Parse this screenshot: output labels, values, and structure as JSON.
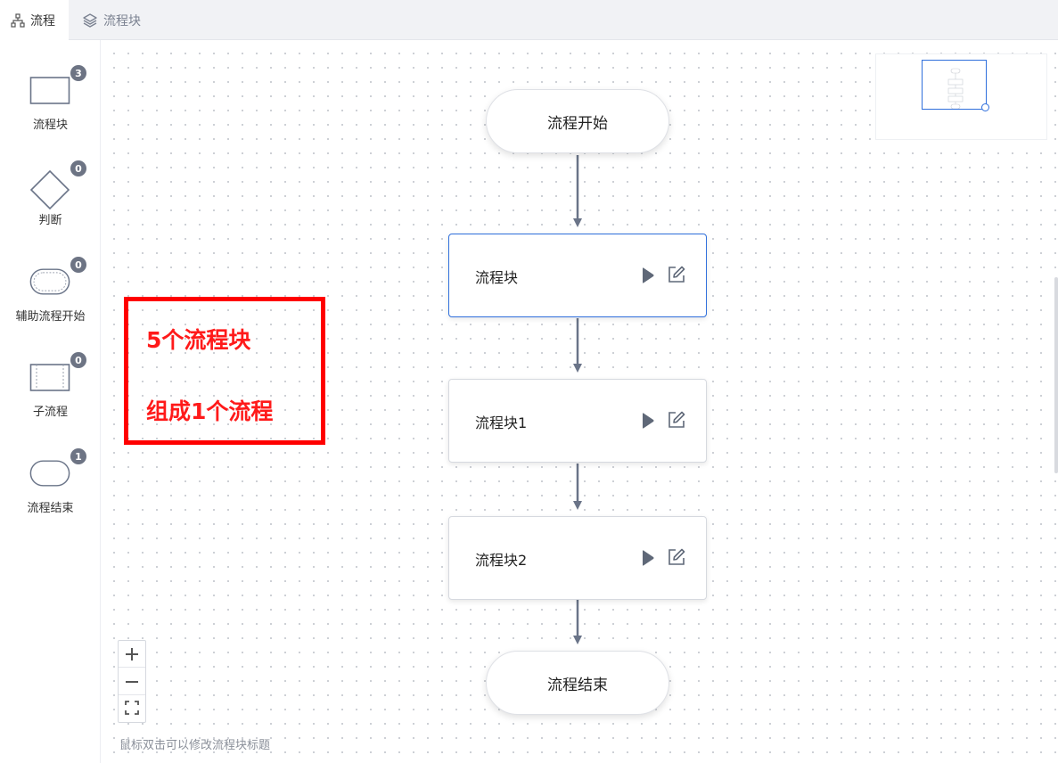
{
  "tabs": [
    {
      "label": "流程",
      "icon": "sitemap-icon",
      "active": true
    },
    {
      "label": "流程块",
      "icon": "layers-icon",
      "active": false
    }
  ],
  "palette": [
    {
      "label": "流程块",
      "count": "3",
      "shape": "rectangle"
    },
    {
      "label": "判断",
      "count": "0",
      "shape": "diamond"
    },
    {
      "label": "辅助流程开始",
      "count": "0",
      "shape": "double-pill"
    },
    {
      "label": "子流程",
      "count": "0",
      "shape": "subprocess"
    },
    {
      "label": "流程结束",
      "count": "1",
      "shape": "pill"
    }
  ],
  "flow": {
    "start": "流程开始",
    "blocks": [
      "流程块",
      "流程块1",
      "流程块2"
    ],
    "end": "流程结束"
  },
  "annotation": {
    "line1": "5个流程块",
    "line2": "组成1个流程",
    "color": "#ff0000"
  },
  "zoom": {
    "in": "+",
    "out": "−",
    "fit": "fit-screen-icon"
  },
  "hint": "鼠标双击可以修改流程块标题",
  "colors": {
    "accent": "#2f6fdc",
    "edge": "#6a7488",
    "badge": "#6d7484"
  }
}
